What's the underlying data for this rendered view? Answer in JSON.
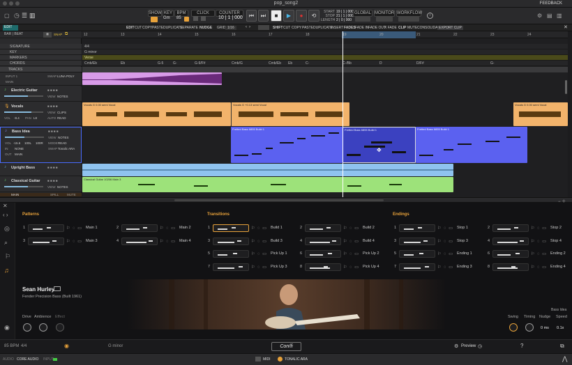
{
  "window": {
    "title": "pop_song2",
    "feedback": "FEEDBACK"
  },
  "toolbar": {
    "show": "SHOW",
    "key": "KEY",
    "bpm": "BPM",
    "click": "CLICK",
    "counter": "COUNTER",
    "key_val": "Gm",
    "bpm_val": "85",
    "counter_val": "10 | 1 | 000",
    "start_lbl": "START",
    "stop_lbl": "STOP",
    "length_lbl": "LENGTH",
    "start_val": "19 | 1 | 000",
    "stop_val": "21 | 1 | 000",
    "length_val": "2 | 0 | 000",
    "global": "GLOBAL",
    "monitor": "MONITOR",
    "workflow": "WORKFLOW"
  },
  "editbar": {
    "edit": "EDIT",
    "edit2": "EDIT",
    "cut": "CUT",
    "copy": "COPY",
    "paste": "PASTE",
    "duplicate": "DUPLICATE",
    "separate": "SEPARATE",
    "nudge": "NUDGE",
    "grid": "GRID",
    "grid_val": "1/16",
    "shift": "SHIFT",
    "cut2": "CUT",
    "copy2": "COPY",
    "paste2": "PASTE",
    "duplicate2": "DUPLICATE",
    "insert": "INSERT",
    "fades": "FADES",
    "fadein": "FADE IN",
    "fadeout": "FADE OUT",
    "xfade": "X FADE",
    "clip": "CLIP",
    "mute": "MUTE",
    "consolidate": "CONSOLIDATE",
    "export": "EXPORT CLIP"
  },
  "left": {
    "barbeat": "BAR | BEAT",
    "snap": "SNAP",
    "signature": "SIGNATURE",
    "key": "KEY",
    "markers": "MARKERS",
    "chords": "CHORDS",
    "tracks": "TRACKS"
  },
  "tracks": [
    {
      "name": "",
      "p1": "INPUT 1",
      "p2": "MAIN",
      "p3": "SWAP",
      "p3v": "LUNA POLY"
    },
    {
      "name": "Electric Guitar",
      "view": "VIEW",
      "viewv": "NOTES"
    },
    {
      "name": "Vocals",
      "view": "VIEW",
      "viewv": "CLIPS",
      "vol": "VOL",
      "volv": "-8.4",
      "pan": "PAN",
      "panv": "L8",
      "auto": "AUTO",
      "autov": "READ"
    },
    {
      "name": "Bass Idea",
      "view": "VIEW",
      "viewv": "NOTES",
      "vol": "VOL",
      "volv": "-15.6",
      "lo": "100L",
      "hi": "100R",
      "in": "IN",
      "inv": "NONE",
      "out": "OUT",
      "outv": "MAIN",
      "mode": "MODE",
      "modev": "READ",
      "swap": "SWAP",
      "swapv": "Tonalic ARA"
    },
    {
      "name": "Upright Bass"
    },
    {
      "name": "Classical Guitar",
      "view": "VIEW",
      "viewv": "NOTES"
    },
    {
      "name": "MAIN",
      "spill": "SPILL",
      "mute": "MUTE"
    }
  ],
  "ruler": [
    "12",
    "13",
    "14",
    "15",
    "16",
    "17",
    "18",
    "19",
    "20",
    "21",
    "22",
    "23",
    "24"
  ],
  "signature": "4/4",
  "keytrack": "G minor",
  "marker": "Verse",
  "chords": [
    "Cmb/Eb",
    "Eb",
    "G-5",
    "G-",
    "G-9/F#",
    "Cmb/G",
    "Cmb/Eb",
    "Eb",
    "C-",
    "C-/Bb",
    "D",
    "D/F#",
    "G-"
  ],
  "clips": {
    "vocal1": "Vocals  G  0.00 semi  Vocal",
    "vocal2": "Vocals  G  +0.13 semi  Vocal",
    "vocal3": "Vocals  G  0.00 semi  Vocal",
    "bass1": "Fretted Bass 6855 Build 1",
    "bass2": "Fretted Bass 6855 Build 1",
    "bass3": "Fretted Bass 6855 Build 1",
    "guitar": "Classical Guitar 10206 Main 3"
  },
  "panel": {
    "patterns_title": "Patterns",
    "transitions_title": "Transitions",
    "endings_title": "Endings",
    "patterns": [
      {
        "n": "1",
        "name": "Main 1"
      },
      {
        "n": "2",
        "name": "Main 2"
      },
      {
        "n": "3",
        "name": "Main 3"
      },
      {
        "n": "4",
        "name": "Main 4"
      }
    ],
    "transitions": [
      {
        "n": "1",
        "name": "Build 1"
      },
      {
        "n": "2",
        "name": "Build 2"
      },
      {
        "n": "3",
        "name": "Build 3"
      },
      {
        "n": "4",
        "name": "Build 4"
      },
      {
        "n": "5",
        "name": "Pick Up 1"
      },
      {
        "n": "6",
        "name": "Pick Up 2"
      },
      {
        "n": "7",
        "name": "Pick Up 3"
      },
      {
        "n": "8",
        "name": "Pick Up 4"
      }
    ],
    "endings": [
      {
        "n": "1",
        "name": "Stop 1"
      },
      {
        "n": "2",
        "name": "Stop 2"
      },
      {
        "n": "3",
        "name": "Stop 3"
      },
      {
        "n": "4",
        "name": "Stop 4"
      },
      {
        "n": "5",
        "name": "Ending 1"
      },
      {
        "n": "6",
        "name": "Ending 2"
      },
      {
        "n": "7",
        "name": "Ending 3"
      },
      {
        "n": "8",
        "name": "Ending 4"
      }
    ],
    "artist": "Sean Hurley",
    "instrument": "Fender Precision Bass (Built 1961)",
    "badge": "Bass Idea",
    "knobs_left": [
      "Drive",
      "Ambience",
      "Effect"
    ],
    "right_labels": [
      "Swing",
      "Timing",
      "Nudge",
      "Speed"
    ],
    "nudge": "0 ms",
    "speed": "0.1x"
  },
  "footer": {
    "bpm": "85 BPM",
    "sig": "4/4",
    "key": "G minor",
    "logo": "Con/fi",
    "preview": "Preview",
    "help": "?"
  },
  "status": {
    "audio": "AUDIO",
    "core": "CORE AUDIO",
    "input": "INPUT",
    "midi": "MIDI",
    "tonalic": "TONALIC ARA"
  }
}
